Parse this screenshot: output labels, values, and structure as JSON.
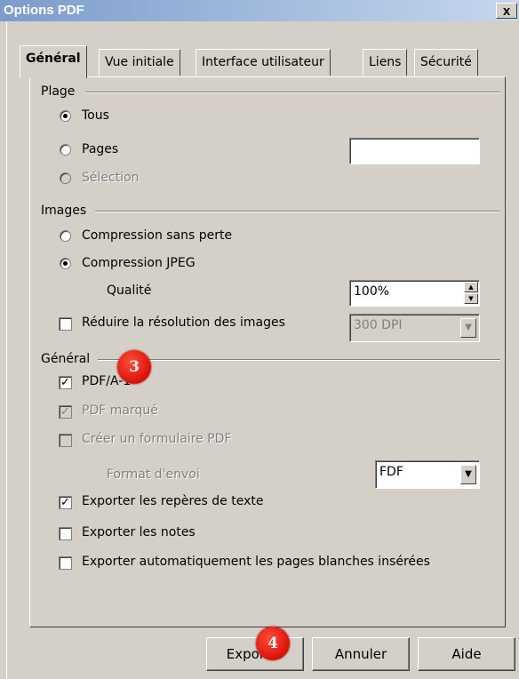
{
  "window": {
    "title": "Options PDF",
    "close_label": "x"
  },
  "tabs": [
    {
      "label": "Général",
      "active": true
    },
    {
      "label": "Vue initiale",
      "active": false
    },
    {
      "label": "Interface utilisateur",
      "active": false
    },
    {
      "label": "Liens",
      "active": false
    },
    {
      "label": "Sécurité",
      "active": false
    }
  ],
  "plage": {
    "title": "Plage",
    "options": [
      {
        "label": "Tous",
        "selected": true,
        "disabled": false
      },
      {
        "label": "Pages",
        "selected": false,
        "disabled": false
      },
      {
        "label": "Sélection",
        "selected": false,
        "disabled": true
      }
    ],
    "pages_value": ""
  },
  "images": {
    "title": "Images",
    "options": [
      {
        "label": "Compression sans perte",
        "selected": false
      },
      {
        "label": "Compression JPEG",
        "selected": true
      }
    ],
    "quality_label": "Qualité",
    "quality_value": "100%",
    "reduce_label": "Réduire la résolution des images",
    "reduce_checked": false,
    "dpi_value": "300 DPI"
  },
  "general": {
    "title": "Général",
    "pdfa_label": "PDF/A-1",
    "pdfa_checked": true,
    "tagged_label": "PDF marqué",
    "tagged_checked": true,
    "form_label": "Créer un formulaire PDF",
    "form_checked": false,
    "format_label": "Format d'envoi",
    "format_value": "FDF",
    "bookmarks_label": "Exporter les repères de texte",
    "bookmarks_checked": true,
    "notes_label": "Exporter les notes",
    "notes_checked": false,
    "blank_label": "Exporter automatiquement les pages blanches insérées",
    "blank_checked": false
  },
  "buttons": {
    "export": "Exporter",
    "cancel": "Annuler",
    "help": "Aide"
  },
  "badges": {
    "b3": "3",
    "b4": "4"
  },
  "check_mark": "✓",
  "colors": {
    "badge": "#e0140a",
    "titlebar": "#8aa8d6"
  }
}
